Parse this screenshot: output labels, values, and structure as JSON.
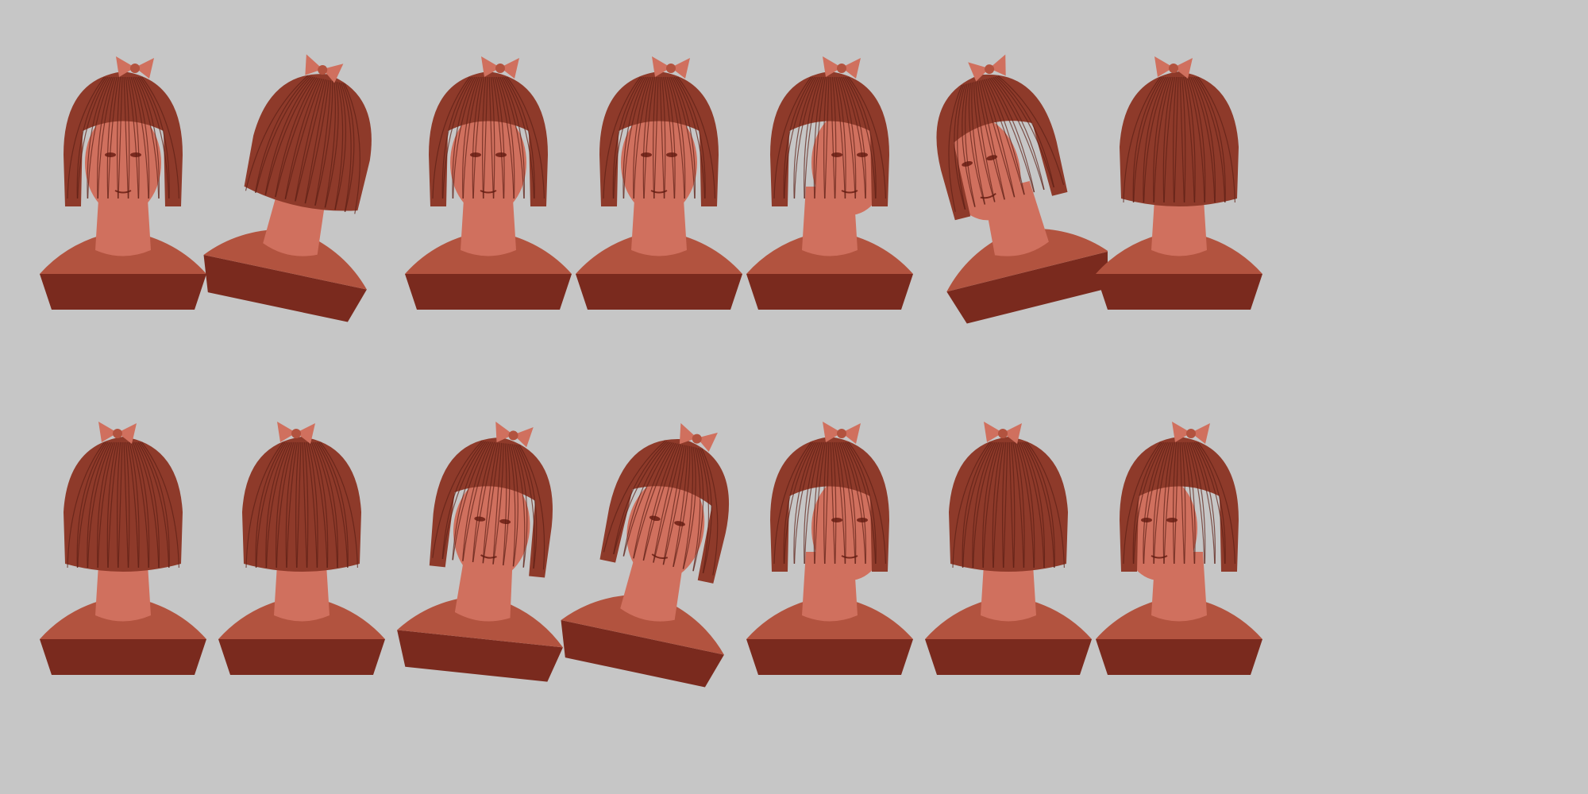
{
  "colors": {
    "background": "#c6c6c6",
    "clay_light": "#d0705e",
    "clay_mid": "#b2533f",
    "clay_dark": "#7a2a1e",
    "hair": "#8e3a2a",
    "hair_strand": "#5c1f16"
  },
  "rows": [
    {
      "busts": [
        {
          "view": "front",
          "icon": "bust-front-icon"
        },
        {
          "view": "back-three-quarter-tilted",
          "icon": "bust-back-tilted-icon"
        },
        {
          "view": "front",
          "icon": "bust-front-icon"
        },
        {
          "view": "front",
          "icon": "bust-front-icon"
        },
        {
          "view": "right-profile",
          "icon": "bust-right-profile-icon"
        },
        {
          "view": "left-three-quarter-tilted",
          "icon": "bust-left-tilted-icon"
        },
        {
          "view": "back-three-quarter",
          "icon": "bust-back-icon"
        }
      ]
    },
    {
      "busts": [
        {
          "view": "back-three-quarter",
          "icon": "bust-back-icon"
        },
        {
          "view": "back",
          "icon": "bust-back-icon"
        },
        {
          "view": "front-looking-down",
          "icon": "bust-front-icon"
        },
        {
          "view": "front-tilted-down",
          "icon": "bust-front-tilted-icon"
        },
        {
          "view": "right-three-quarter",
          "icon": "bust-right-profile-icon"
        },
        {
          "view": "back-left-profile",
          "icon": "bust-back-icon"
        },
        {
          "view": "left-profile",
          "icon": "bust-left-profile-icon"
        }
      ]
    }
  ]
}
